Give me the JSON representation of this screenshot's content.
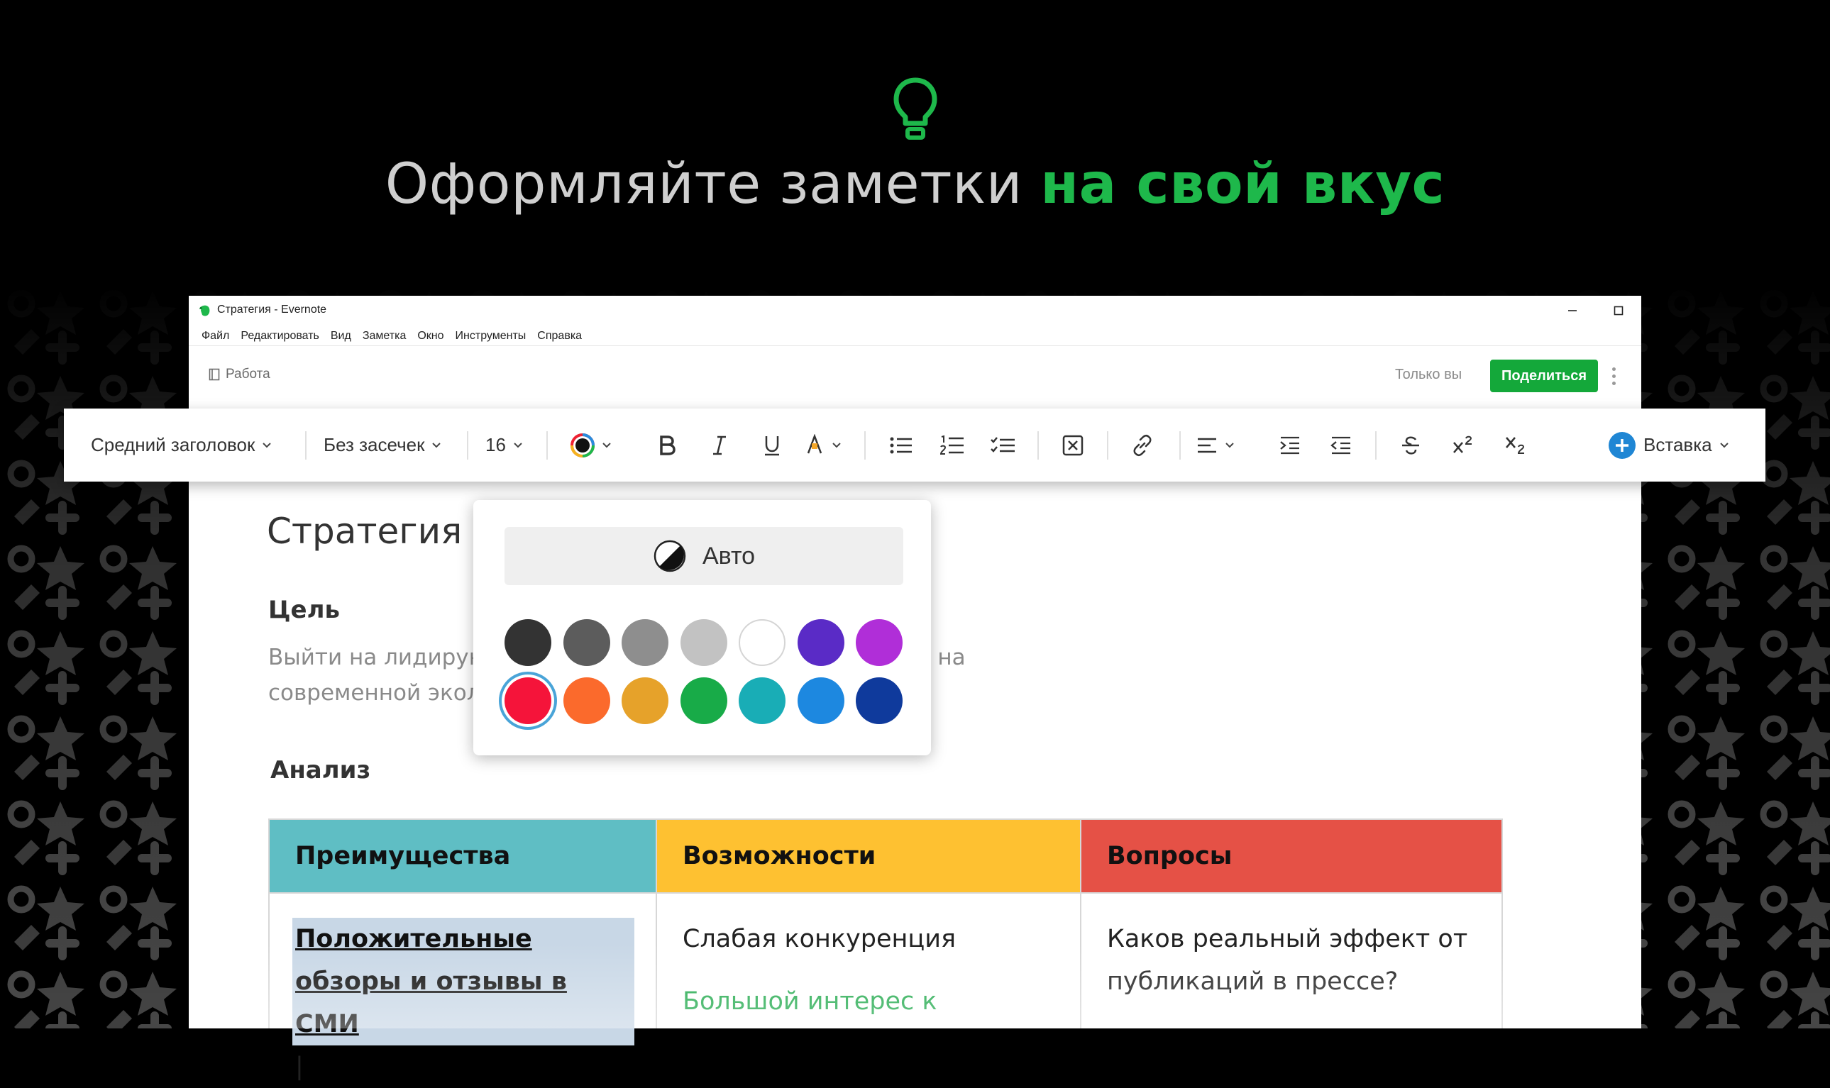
{
  "hero": {
    "title_prefix": "Оформляйте заметки ",
    "title_accent": "на свой вкус",
    "accent_color": "#1eb84b",
    "icon": "lightbulb-icon"
  },
  "window": {
    "title": "Стратегия - Evernote",
    "menu": [
      "Файл",
      "Редактировать",
      "Вид",
      "Заметка",
      "Окно",
      "Инструменты",
      "Справка"
    ],
    "controls": [
      "minimize-icon",
      "maximize-icon",
      "close-icon"
    ]
  },
  "note_header": {
    "notebook": "Работа",
    "visibility": "Только вы",
    "share_label": "Поделиться",
    "share_color": "#14a83a"
  },
  "toolbar": {
    "style_label": "Средний заголовок",
    "font_label": "Без засечек",
    "size_label": "16",
    "insert_label": "Вставка",
    "tools": [
      "text-color-icon",
      "bold-icon",
      "italic-icon",
      "underline-icon",
      "highlight-icon",
      "bullet-list-icon",
      "numbered-list-icon",
      "checklist-icon",
      "remove-format-icon",
      "link-icon",
      "align-icon",
      "indent-icon",
      "outdent-icon",
      "strikethrough-icon",
      "superscript-icon",
      "subscript-icon"
    ]
  },
  "color_picker": {
    "auto_label": "Авто",
    "selected_color": "#f5143a",
    "colors_row1": [
      "#333333",
      "#5c5c5c",
      "#8e8e8e",
      "#c2c2c2",
      "#ffffff",
      "#5a2bc6",
      "#b02ed8"
    ],
    "colors_row2": [
      "#f5143a",
      "#fb6a2c",
      "#e6a22a",
      "#18ab48",
      "#19adb6",
      "#1d88e0",
      "#0f3a9c"
    ]
  },
  "note": {
    "title": "Стратегия",
    "goal_heading": "Цель",
    "goal_text": "Выйти на лидирующие позиции на рынке, ориентируясь на современной эколо...",
    "analysis_heading": "Анализ",
    "table": {
      "headers": [
        "Преимущества",
        "Возможности",
        "Вопросы"
      ],
      "header_colors": [
        "#5fbec4",
        "#fec131",
        "#e55146"
      ],
      "cell1": "Положительные обзоры и отзывы в СМИ",
      "cell2": "Слабая конкуренция",
      "cell2_extra": "Большой интерес к",
      "cell3": "Каков реальный эффект от публикаций в прессе?"
    }
  }
}
